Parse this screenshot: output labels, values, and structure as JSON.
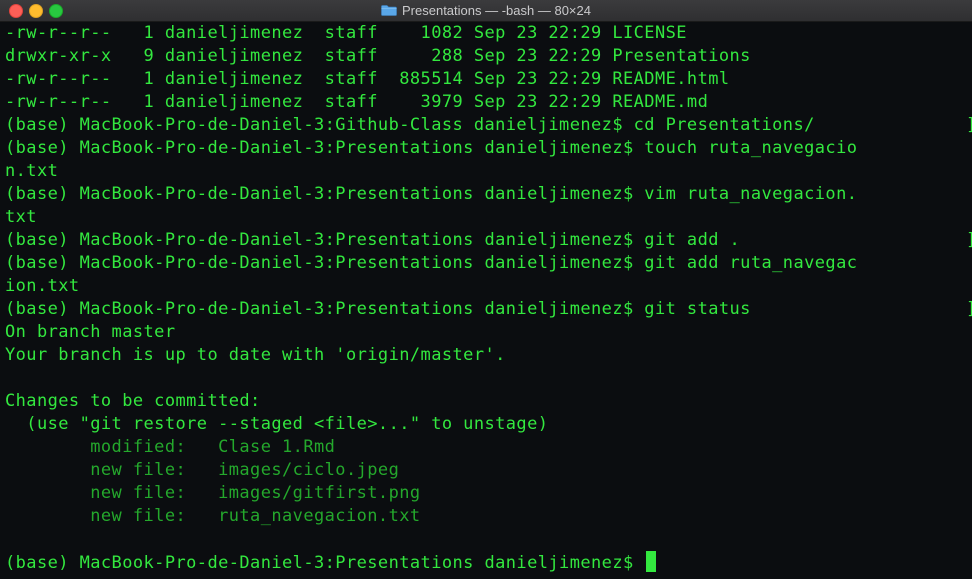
{
  "window": {
    "title": "Presentations — -bash — 80×24",
    "folder_icon": "folder-icon",
    "colors": {
      "background": "#0b0d10",
      "text": "#33e83f",
      "dim_text": "#24a82c",
      "titlebar": "#3b3b3d"
    }
  },
  "terminal": {
    "lines": [
      "-rw-r--r--   1 danieljimenez  staff    1082 Sep 23 22:29 LICENSE",
      "drwxr-xr-x   9 danieljimenez  staff     288 Sep 23 22:29 Presentations",
      "-rw-r--r--   1 danieljimenez  staff  885514 Sep 23 22:29 README.html",
      "-rw-r--r--   1 danieljimenez  staff    3979 Sep 23 22:29 README.md",
      "(base) MacBook-Pro-de-Daniel-3:Github-Class danieljimenez$ cd Presentations/",
      "(base) MacBook-Pro-de-Daniel-3:Presentations danieljimenez$ touch ruta_navegacio",
      "n.txt",
      "(base) MacBook-Pro-de-Daniel-3:Presentations danieljimenez$ vim ruta_navegacion.",
      "txt",
      "(base) MacBook-Pro-de-Daniel-3:Presentations danieljimenez$ git add .",
      "(base) MacBook-Pro-de-Daniel-3:Presentations danieljimenez$ git add ruta_navegac",
      "ion.txt",
      "(base) MacBook-Pro-de-Daniel-3:Presentations danieljimenez$ git status",
      "On branch master",
      "Your branch is up to date with 'origin/master'.",
      "",
      "Changes to be committed:",
      "  (use \"git restore --staged <file>...\" to unstage)",
      "        modified:   Clase 1.Rmd",
      "        new file:   images/ciclo.jpeg",
      "        new file:   images/gitfirst.png",
      "        new file:   ruta_navegacion.txt",
      "",
      "(base) MacBook-Pro-de-Daniel-3:Presentations danieljimenez$ "
    ]
  }
}
